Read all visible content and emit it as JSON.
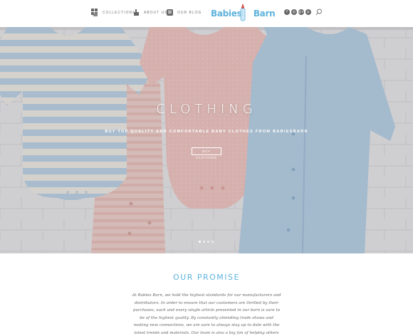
{
  "nav": {
    "collections": {
      "label": "Collections",
      "icon": "grid-icon"
    },
    "about": {
      "label": "About Us",
      "icon": "hand-icon"
    },
    "blog": {
      "label": "Our Blog",
      "icon": "blog-icon"
    }
  },
  "logo": {
    "word1": "Babies'",
    "word2": "Barn",
    "icon": "baby-bottle-icon"
  },
  "social": {
    "facebook": "f",
    "instagram": "◎",
    "googleplus": "g+",
    "pinterest": "p"
  },
  "hero": {
    "title": "CLOTHING",
    "subtitle": "Buy top quality and comfortable baby clothes from BabiesBarn",
    "button": "Buy Clothing",
    "slides": 4,
    "active_slide": 1
  },
  "promise": {
    "title": "OUR PROMISE",
    "text": "At Babies Barn, we hold the highest standards for our manufacturers and distributors. In order to ensure that our customers are thrilled by their purchases, each and every single article presented in our barn is sure to be of the highest quality. By constantly attending trade shows and making new connections, we are sure to always stay up to date with the latest trends and materials. Our team is also a big fan of helping others succeed! We"
  },
  "colors": {
    "accent": "#5fb3dd",
    "bottle_red": "#d9534f"
  }
}
